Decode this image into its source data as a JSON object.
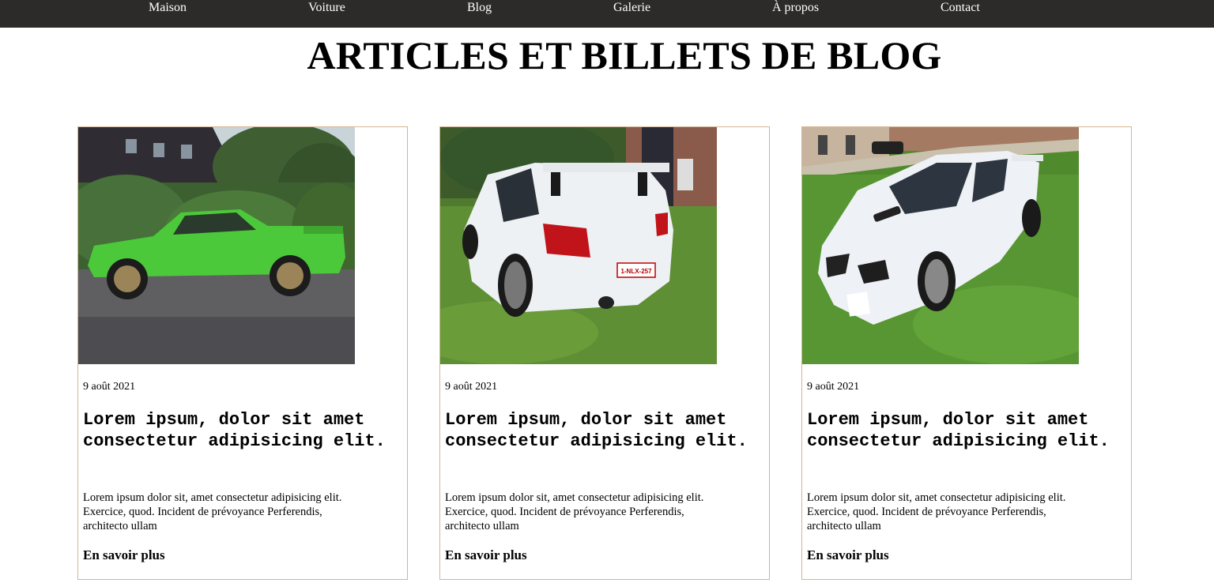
{
  "nav": {
    "items": [
      {
        "label": "Maison"
      },
      {
        "label": "Voiture"
      },
      {
        "label": "Blog"
      },
      {
        "label": "Galerie"
      },
      {
        "label": "À propos"
      },
      {
        "label": "Contact"
      }
    ]
  },
  "page": {
    "title": "ARTICLES ET BILLETS DE BLOG"
  },
  "colors": {
    "navbar_bg": "#2c2b2a",
    "card_border": "#d8b48c",
    "text": "#000000"
  },
  "cards": [
    {
      "image": "green-bmw-e30-photo",
      "date": "9 août 2021",
      "title": "Lorem ipsum, dolor sit amet consectetur adipisicing elit.",
      "excerpt": "Lorem ipsum dolor sit, amet consectetur adipisicing elit. Exercice, quod. Incident de prévoyance Perferendis, architecto ullam",
      "link": "En savoir plus"
    },
    {
      "image": "white-subaru-rear-photo",
      "plate": "1-NLX-257",
      "date": "9 août 2021",
      "title": "Lorem ipsum, dolor sit amet consectetur adipisicing elit.",
      "excerpt": "Lorem ipsum dolor sit, amet consectetur adipisicing elit. Exercice, quod. Incident de prévoyance Perferendis, architecto ullam",
      "link": "En savoir plus"
    },
    {
      "image": "white-subaru-front-photo",
      "date": "9 août 2021",
      "title": "Lorem ipsum, dolor sit amet consectetur adipisicing elit.",
      "excerpt": "Lorem ipsum dolor sit, amet consectetur adipisicing elit. Exercice, quod. Incident de prévoyance Perferendis, architecto ullam",
      "link": "En savoir plus"
    }
  ]
}
